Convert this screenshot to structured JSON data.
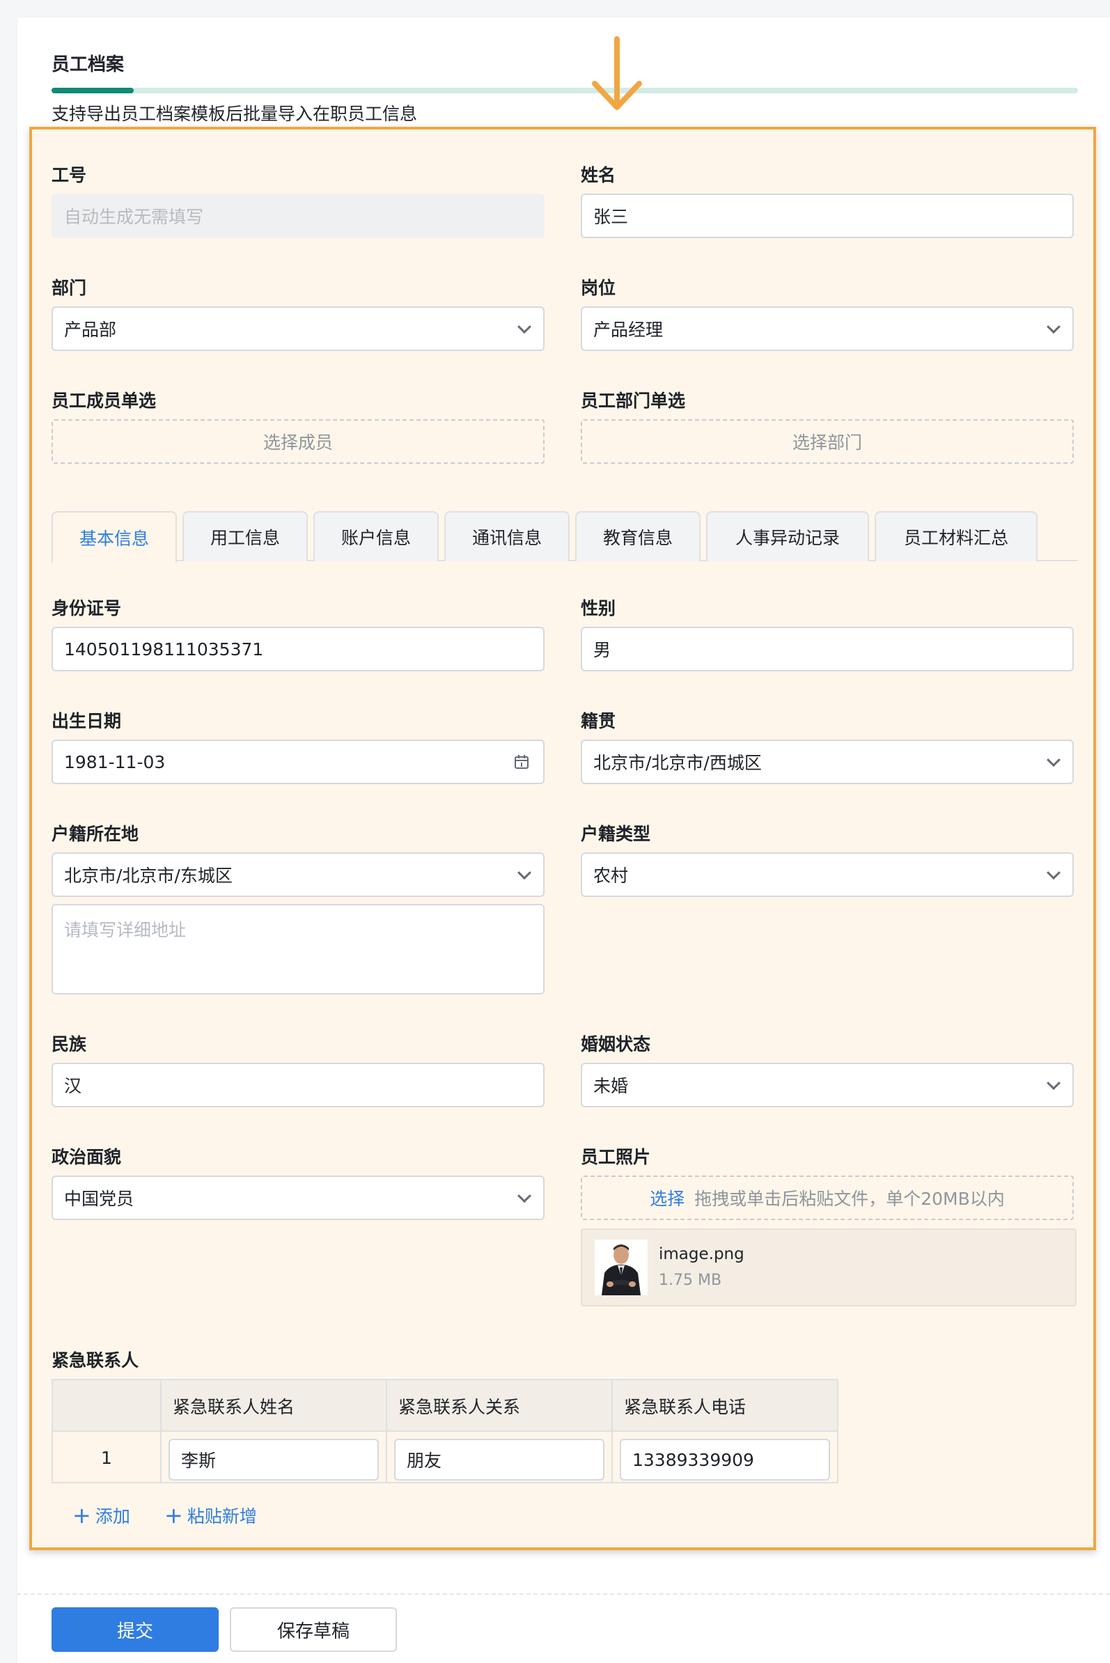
{
  "header": {
    "title": "员工档案",
    "subtitle": "支持导出员工档案模板后批量导入在职员工信息",
    "progress": 0.08
  },
  "fields": {
    "emp_no": {
      "label": "工号",
      "placeholder": "自动生成无需填写"
    },
    "name": {
      "label": "姓名",
      "value": "张三"
    },
    "dept": {
      "label": "部门",
      "value": "产品部"
    },
    "position": {
      "label": "岗位",
      "value": "产品经理"
    },
    "member_pick": {
      "label": "员工成员单选",
      "placeholder": "选择成员"
    },
    "dept_pick": {
      "label": "员工部门单选",
      "placeholder": "选择部门"
    },
    "id_no": {
      "label": "身份证号",
      "value": "140501198111035371"
    },
    "gender": {
      "label": "性别",
      "value": "男"
    },
    "birth": {
      "label": "出生日期",
      "value": "1981-11-03"
    },
    "native": {
      "label": "籍贯",
      "value": "北京市/北京市/西城区"
    },
    "hukou": {
      "label": "户籍所在地",
      "value": "北京市/北京市/东城区",
      "detail_placeholder": "请填写详细地址"
    },
    "hukou_type": {
      "label": "户籍类型",
      "value": "农村"
    },
    "ethnic": {
      "label": "民族",
      "value": "汉"
    },
    "marital": {
      "label": "婚姻状态",
      "value": "未婚"
    },
    "political": {
      "label": "政治面貌",
      "value": "中国党员"
    },
    "photo": {
      "label": "员工照片",
      "pick_label": "选择",
      "hint": "拖拽或单击后粘贴文件，单个20MB以内",
      "file_name": "image.png",
      "file_size": "1.75 MB"
    }
  },
  "tabs": [
    {
      "label": "基本信息",
      "active": true
    },
    {
      "label": "用工信息"
    },
    {
      "label": "账户信息"
    },
    {
      "label": "通讯信息"
    },
    {
      "label": "教育信息"
    },
    {
      "label": "人事异动记录"
    },
    {
      "label": "员工材料汇总"
    }
  ],
  "emergency": {
    "label": "紧急联系人",
    "columns": [
      "紧急联系人姓名",
      "紧急联系人关系",
      "紧急联系人电话"
    ],
    "rows": [
      {
        "index": "1",
        "name": "李斯",
        "relation": "朋友",
        "phone": "13389339909"
      }
    ],
    "add_label": "添加",
    "paste_label": "粘贴新增"
  },
  "actions": {
    "submit": "提交",
    "save_draft": "保存草稿"
  },
  "colors": {
    "accent_blue": "#2f7de1",
    "progress_green": "#0f8a76",
    "highlight_orange": "#f0a742"
  }
}
